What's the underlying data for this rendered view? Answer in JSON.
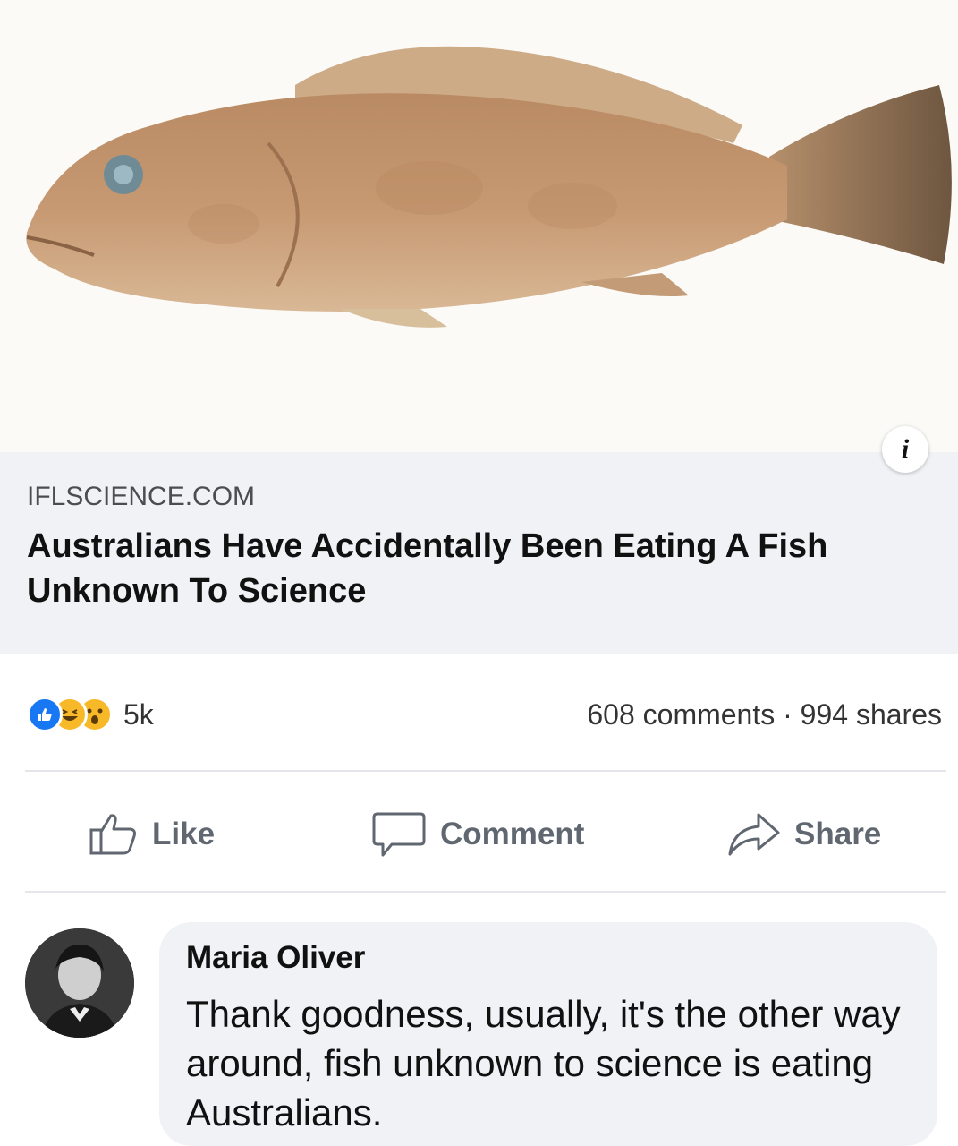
{
  "link_preview": {
    "domain": "IFLSCIENCE.COM",
    "headline": "Australians Have Accidentally Been Eating A Fish Unknown To Science",
    "image_subject": "grouper-fish",
    "info_icon": "info-icon"
  },
  "stats": {
    "reaction_icons": [
      "like-icon",
      "haha-icon",
      "wow-icon"
    ],
    "reaction_count": "5k",
    "comments": "608 comments",
    "separator": "·",
    "shares": "994 shares"
  },
  "actions": {
    "like_label": "Like",
    "comment_label": "Comment",
    "share_label": "Share"
  },
  "comment": {
    "author": "Maria Oliver",
    "text": "Thank goodness, usually, it's the other way around, fish unknown to science is eating Australians."
  },
  "colors": {
    "like_blue": "#1877f2",
    "reaction_yellow": "#f7b928",
    "link_box_bg": "#f0f2f5",
    "action_gray": "#606770"
  }
}
